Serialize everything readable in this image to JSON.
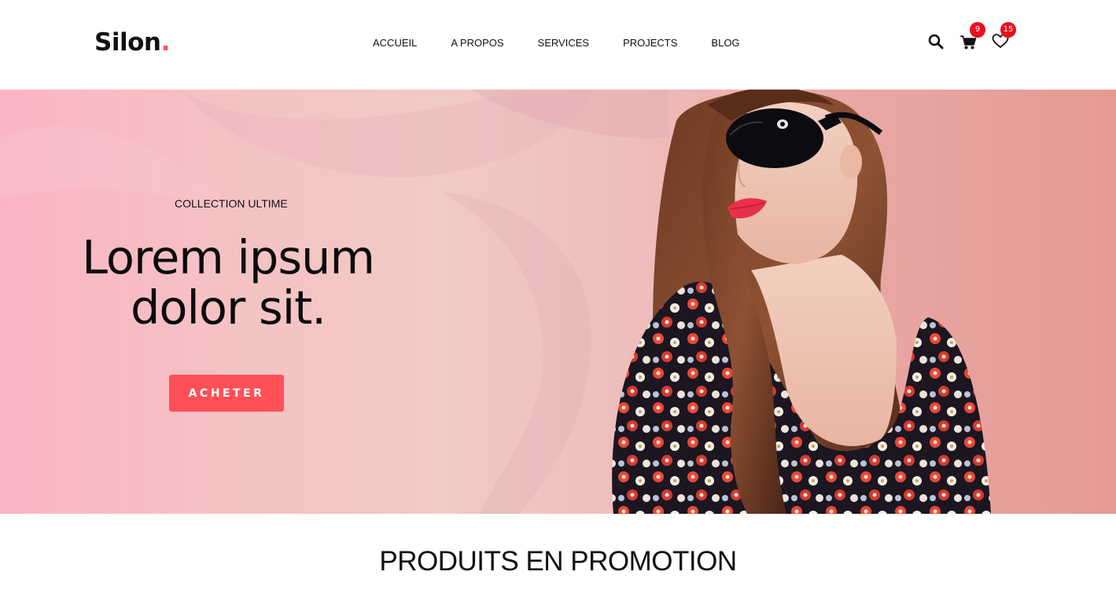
{
  "brand": {
    "name": "Silon",
    "dot": ".",
    "accent_color": "#ff4d57"
  },
  "nav": {
    "items": [
      {
        "label": "ACCUEIL"
      },
      {
        "label": "A PROPOS"
      },
      {
        "label": "SERVICES"
      },
      {
        "label": "PROJECTS"
      },
      {
        "label": "BLOG"
      }
    ]
  },
  "header_icons": {
    "search": {
      "icon": "search-icon"
    },
    "cart": {
      "icon": "cart-icon",
      "count": "9"
    },
    "wishlist": {
      "icon": "heart-icon",
      "count": "15"
    },
    "badge_color": "#e8101e"
  },
  "hero": {
    "kicker": "COLLECTION ULTIME",
    "title_line1": "Lorem ipsum",
    "title_line2": "dolor sit.",
    "cta_label": "ACHETER",
    "cta_color": "#ff5057",
    "image": "woman-sunglasses-floral-photo"
  },
  "section": {
    "title": "PRODUITS EN PROMOTION"
  }
}
